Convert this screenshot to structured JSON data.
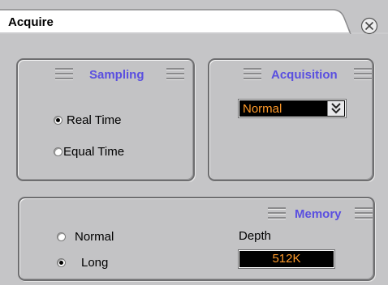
{
  "window": {
    "title": "Acquire"
  },
  "sampling": {
    "title": "Sampling",
    "options": [
      {
        "label": "Real Time",
        "checked": true
      },
      {
        "label": "Equal Time",
        "checked": false
      }
    ]
  },
  "acquisition": {
    "title": "Acquisition",
    "selected": "Normal"
  },
  "memory": {
    "title": "Memory",
    "options": [
      {
        "label": "Normal",
        "checked": false
      },
      {
        "label": "Long",
        "checked": true
      }
    ],
    "depth_label": "Depth",
    "depth_value": "512K"
  },
  "colors": {
    "panel_title": "#5a4fe0",
    "readout_text": "#ff9a2a",
    "readout_bg": "#000000"
  },
  "icons": {
    "close": "circle-x-icon",
    "dropdown": "double-chevron-down-icon",
    "grip": "grip-lines-icon"
  }
}
